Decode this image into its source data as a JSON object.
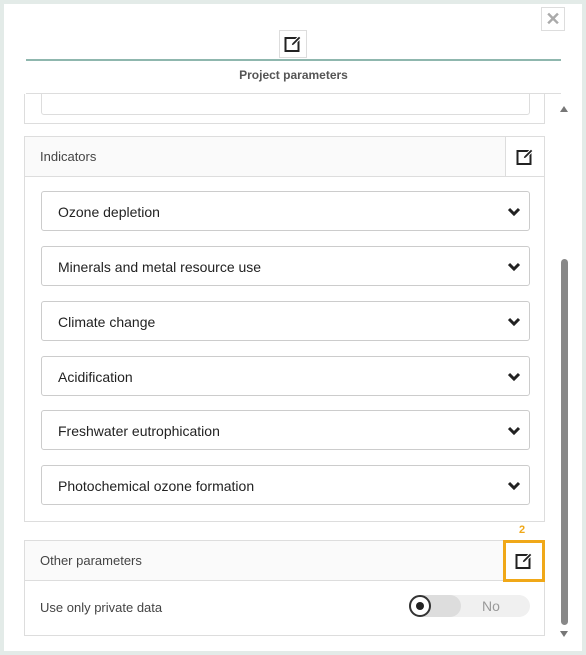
{
  "dialog": {
    "close_icon": "close-icon",
    "header_edit_icon": "edit-icon",
    "title": "Project parameters"
  },
  "indicators": {
    "title": "Indicators",
    "edit_icon": "edit-icon",
    "items": [
      {
        "label": "Ozone depletion"
      },
      {
        "label": "Minerals and metal resource use"
      },
      {
        "label": "Climate change"
      },
      {
        "label": "Acidification"
      },
      {
        "label": "Freshwater eutrophication"
      },
      {
        "label": "Photochemical ozone formation"
      }
    ]
  },
  "other_parameters": {
    "title": "Other parameters",
    "badge": "2",
    "highlight_color": "#f0a818",
    "edit_icon": "edit-icon",
    "private_data_label": "Use only private data",
    "private_data_value": "No"
  },
  "colors": {
    "accent_line": "#8fb7ae",
    "highlight": "#f0a818"
  }
}
